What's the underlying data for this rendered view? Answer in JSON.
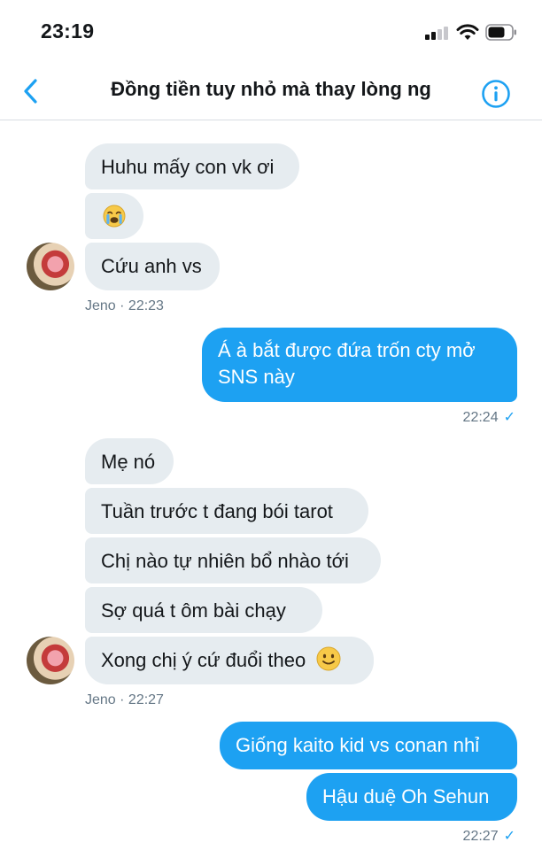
{
  "status_bar": {
    "time": "23:19"
  },
  "header": {
    "title": "Đồng tiền tuy nhỏ mà thay lòng ng"
  },
  "messages": [
    {
      "text": "Huhu mấy con vk ơi"
    },
    {
      "text": ""
    },
    {
      "text": "Cứu anh vs"
    },
    {
      "meta": "Jeno · 22:23"
    },
    {
      "text": "Á à bắt được đứa trốn cty mở"
    },
    {
      "text": "SNS này"
    },
    {
      "meta": "22:24"
    },
    {
      "text": "Mẹ nó"
    },
    {
      "text": "Tuần trước t đang bói tarot"
    },
    {
      "text": "Chị nào tự nhiên bổ nhào tới"
    },
    {
      "text": "Sợ quá t ôm bài chạy"
    },
    {
      "text": "Xong chị ý cứ đuổi theo"
    },
    {
      "meta": "Jeno · 22:27"
    },
    {
      "text": "Giống kaito kid vs conan nhỉ"
    },
    {
      "text": "Hậu duệ Oh Sehun"
    },
    {
      "meta": "22:27"
    }
  ],
  "icons": {
    "back": "chevron-left-icon",
    "info": "info-icon",
    "crying": "crying-face-emoji",
    "smile": "smiling-face-emoji",
    "read": "checkmark-icon"
  },
  "colors": {
    "accent": "#1da1f2",
    "incoming_bubble": "#e6ecf0",
    "meta_text": "#657786"
  }
}
